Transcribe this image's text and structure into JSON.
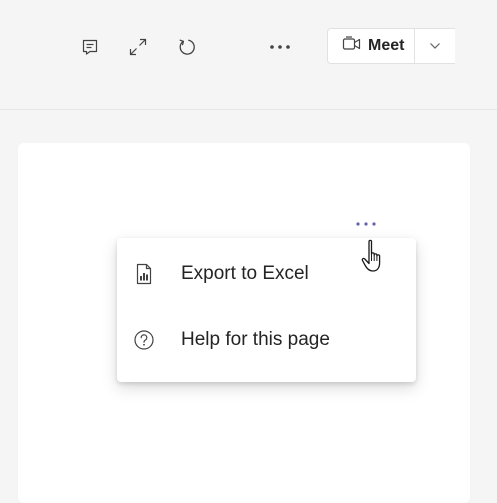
{
  "header": {
    "icons": {
      "chat": "chat-icon",
      "expand": "expand-icon",
      "refresh": "refresh-icon",
      "more": "more-options-icon"
    },
    "meet_label": "Meet"
  },
  "card": {
    "more_icon": "ellipsis-icon"
  },
  "context_menu": {
    "items": [
      {
        "icon": "excel-report-icon",
        "label": "Export to Excel"
      },
      {
        "icon": "help-circle-icon",
        "label": "Help for this page"
      }
    ]
  },
  "colors": {
    "accent": "#6264a7",
    "background": "#f5f5f5",
    "surface": "#ffffff",
    "text": "#242424"
  }
}
